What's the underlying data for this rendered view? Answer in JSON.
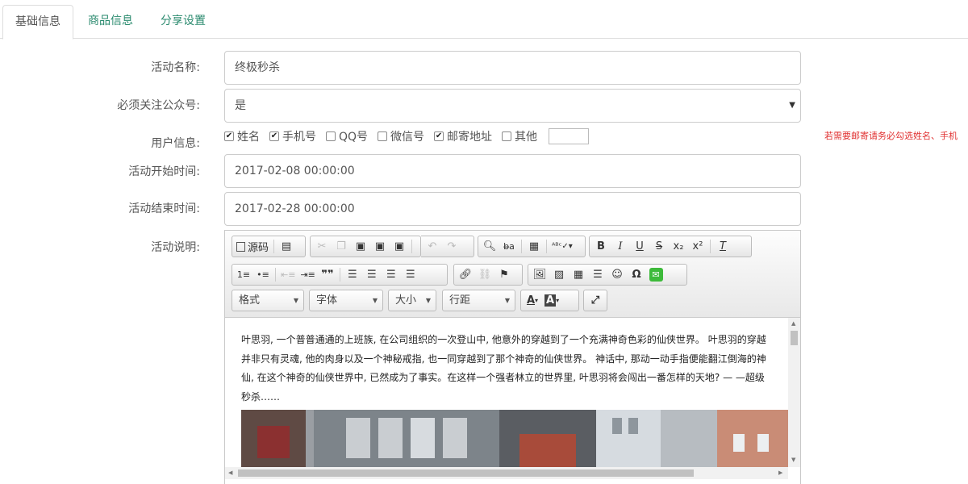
{
  "tabs": [
    "基础信息",
    "商品信息",
    "分享设置"
  ],
  "form": {
    "name_label": "活动名称:",
    "name_value": "终极秒杀",
    "follow_label": "必须关注公众号:",
    "follow_value": "是",
    "userinfo_label": "用户信息:",
    "checks": [
      {
        "label": "姓名",
        "checked": true
      },
      {
        "label": "手机号",
        "checked": true
      },
      {
        "label": "QQ号",
        "checked": false
      },
      {
        "label": "微信号",
        "checked": false
      },
      {
        "label": "邮寄地址",
        "checked": true
      },
      {
        "label": "其他",
        "checked": false
      }
    ],
    "hint": "若需要邮寄请务必勾选姓名、手机",
    "start_label": "活动开始时间:",
    "start_value": "2017-02-08 00:00:00",
    "end_label": "活动结束时间:",
    "end_value": "2017-02-28 00:00:00",
    "desc_label": "活动说明:"
  },
  "editor": {
    "source_label": "源码",
    "combos": [
      "格式",
      "字体",
      "大小",
      "行距"
    ],
    "content": "叶思羽, 一个普普通通的上班族, 在公司组织的一次登山中, 他意外的穿越到了一个充满神奇色彩的仙侠世界。  叶思羽的穿越并非只有灵魂, 他的肉身以及一个神秘戒指, 也一同穿越到了那个神奇的仙侠世界。  神话中, 那动一动手指便能翻江倒海的神仙, 在这个神奇的仙侠世界中, 已然成为了事实。在这样一个强者林立的世界里, 叶思羽将会闯出一番怎样的天地? — —超级秒杀……"
  },
  "colors": {
    "accent": "#2a8a6e",
    "hint": "#e03030"
  }
}
